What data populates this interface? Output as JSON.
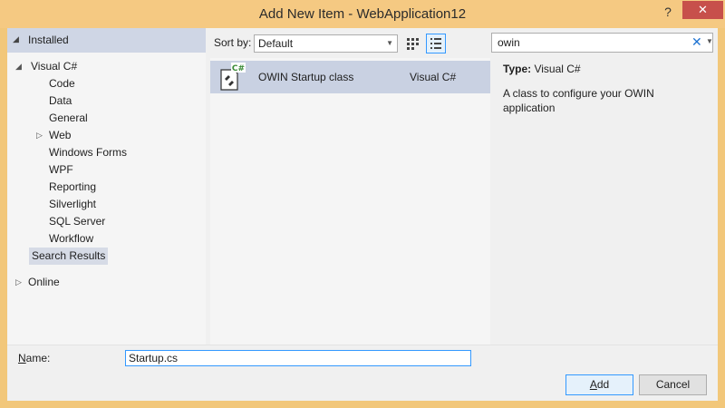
{
  "window": {
    "title": "Add New Item - WebApplication12",
    "help_label": "?",
    "close_label": "✕"
  },
  "left": {
    "installed_label": "Installed",
    "tree": [
      {
        "label": "Visual C#",
        "level": 0,
        "expander": "expanded"
      },
      {
        "label": "Code",
        "level": 1
      },
      {
        "label": "Data",
        "level": 1
      },
      {
        "label": "General",
        "level": 1
      },
      {
        "label": "Web",
        "level": 1,
        "expander": "collapsed"
      },
      {
        "label": "Windows Forms",
        "level": 1
      },
      {
        "label": "WPF",
        "level": 1
      },
      {
        "label": "Reporting",
        "level": 1
      },
      {
        "label": "Silverlight",
        "level": 1
      },
      {
        "label": "SQL Server",
        "level": 1
      },
      {
        "label": "Workflow",
        "level": 1
      },
      {
        "label": "Search Results",
        "level": 0,
        "selected": true
      },
      {
        "label": "Online",
        "level": 0,
        "expander": "collapsed"
      }
    ]
  },
  "toolbar": {
    "sort_label": "Sort by:",
    "sort_value": "Default"
  },
  "search": {
    "value": "owin",
    "clear_glyph": "✕"
  },
  "templates": [
    {
      "name": "OWIN Startup class",
      "language": "Visual C#",
      "icon_badge": "C#",
      "selected": true
    }
  ],
  "info": {
    "type_label": "Type:",
    "type_value": "Visual C#",
    "description": "A class to configure your OWIN application"
  },
  "footer": {
    "name_label_prefix": "",
    "name_label_accel": "N",
    "name_label_rest": "ame:",
    "name_value": "Startup.cs",
    "add_accel": "A",
    "add_rest": "dd",
    "cancel_label": "Cancel"
  },
  "colors": {
    "title_bar": "#f5c982",
    "close_button": "#c7504b",
    "selection": "#c9d1e2",
    "focus_border": "#3399ff"
  }
}
